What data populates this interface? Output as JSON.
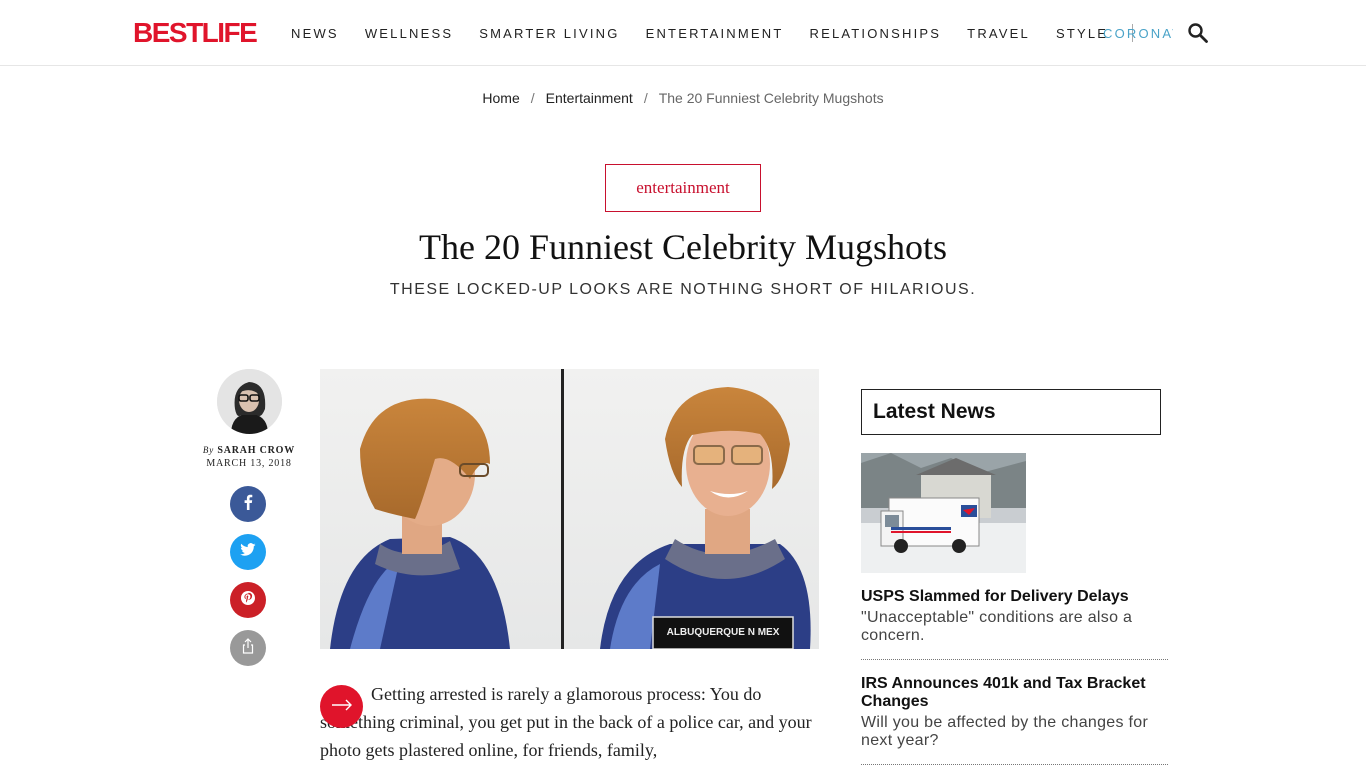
{
  "header": {
    "logo": "BESTLIFE",
    "nav": [
      "NEWS",
      "WELLNESS",
      "SMARTER LIVING",
      "ENTERTAINMENT",
      "RELATIONSHIPS",
      "TRAVEL",
      "STYLE"
    ],
    "nav_extra": "CORONAVIRUS",
    "search_icon": "search-icon"
  },
  "breadcrumb": {
    "home": "Home",
    "section": "Entertainment",
    "current": "The 20 Funniest Celebrity Mugshots",
    "separator": "/"
  },
  "article": {
    "category": "entertainment",
    "title": "The 20 Funniest Celebrity Mugshots",
    "subtitle": "THESE LOCKED-UP LOOKS ARE NOTHING SHORT OF HILARIOUS.",
    "by": "By",
    "author": "SARAH CROW",
    "date": "MARCH 13, 2018",
    "placard": "ALBUQUERQUE N MEX",
    "lead": "Getting arrested is rarely a glamorous process: You do something criminal, you get put in the back of a police car, and your photo gets plastered online, for friends, family,"
  },
  "share": {
    "facebook_icon": "facebook-icon",
    "twitter_icon": "twitter-icon",
    "pinterest_icon": "pinterest-icon",
    "share_icon": "share-icon"
  },
  "sidebar": {
    "heading": "Latest News",
    "items": [
      {
        "title": "USPS Slammed for Delivery Delays",
        "desc": "\"Unacceptable\" conditions are also a concern."
      },
      {
        "title": "IRS Announces 401k and Tax Bracket Changes",
        "desc": "Will you be affected by the changes for next year?"
      }
    ]
  },
  "colors": {
    "brand": "#e0142b",
    "accent_link": "#4aa3c8",
    "facebook": "#3b5998",
    "twitter": "#1da1f2",
    "pinterest": "#cb2027"
  }
}
